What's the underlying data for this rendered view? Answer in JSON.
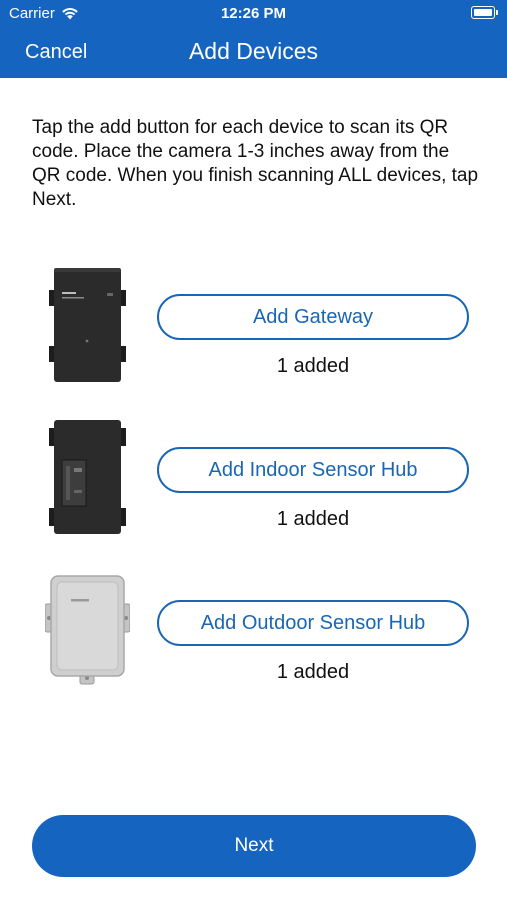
{
  "status_bar": {
    "carrier": "Carrier",
    "time": "12:26 PM"
  },
  "nav": {
    "cancel_label": "Cancel",
    "title": "Add Devices"
  },
  "instructions": "Tap the add button for each device to scan its QR code. Place the camera 1-3 inches away from the QR code. When you finish scanning ALL devices, tap Next.",
  "devices": [
    {
      "button_label": "Add Gateway",
      "status": "1 added",
      "icon": "gateway-device-image"
    },
    {
      "button_label": "Add Indoor Sensor Hub",
      "status": "1 added",
      "icon": "indoor-sensor-hub-image"
    },
    {
      "button_label": "Add Outdoor Sensor Hub",
      "status": "1 added",
      "icon": "outdoor-sensor-hub-image"
    }
  ],
  "next_label": "Next",
  "colors": {
    "brand_blue": "#1565c0",
    "button_outline": "#1a66b3"
  }
}
